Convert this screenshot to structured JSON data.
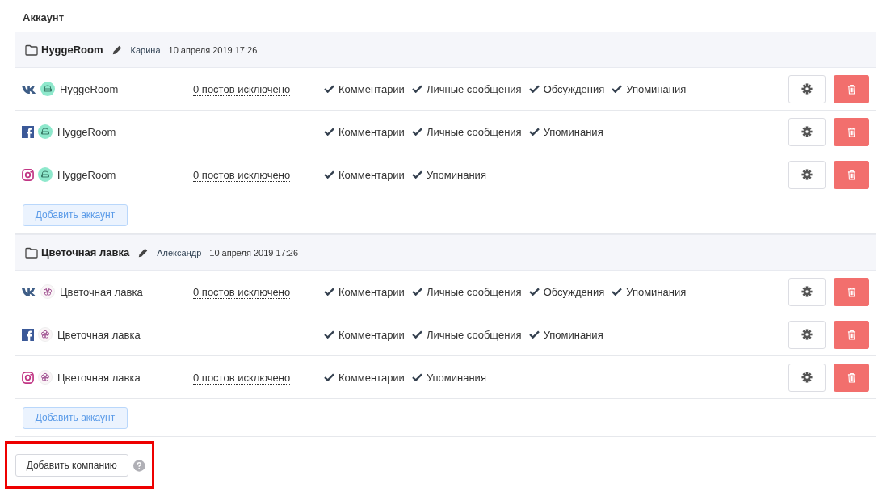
{
  "title": "Аккаунт",
  "groups": [
    {
      "name": "HyggeRoom",
      "author": "Карина",
      "date": "10 апреля 2019 17:26",
      "avatar": {
        "kind": "chair"
      },
      "accounts": [
        {
          "kind": "vk",
          "name": "HyggeRoom",
          "excluded": "0 постов исключено",
          "permissions": [
            "Комментарии",
            "Личные сообщения",
            "Обсуждения",
            "Упоминания"
          ]
        },
        {
          "kind": "facebook",
          "name": "HyggeRoom",
          "permissions": [
            "Комментарии",
            "Личные сообщения",
            "Упоминания"
          ]
        },
        {
          "kind": "instagram",
          "name": "HyggeRoom",
          "excluded": "0 постов исключено",
          "permissions": [
            "Комментарии",
            "Упоминания"
          ]
        }
      ],
      "add_button": "Добавить аккаунт"
    },
    {
      "name": "Цветочная лавка",
      "author": "Александр",
      "date": "10 апреля 2019 17:26",
      "avatar": {
        "kind": "flower"
      },
      "accounts": [
        {
          "kind": "vk",
          "name": "Цветочная лавка",
          "excluded": "0 постов исключено",
          "permissions": [
            "Комментарии",
            "Личные сообщения",
            "Обсуждения",
            "Упоминания"
          ]
        },
        {
          "kind": "facebook",
          "name": "Цветочная лавка",
          "permissions": [
            "Комментарии",
            "Личные сообщения",
            "Упоминания"
          ]
        },
        {
          "kind": "instagram",
          "name": "Цветочная лавка",
          "excluded": "0 постов исключено",
          "permissions": [
            "Комментарии",
            "Упоминания"
          ]
        }
      ],
      "add_button": "Добавить аккаунт"
    }
  ],
  "add_company": {
    "label": "Добавить компанию",
    "highlighted": true
  }
}
